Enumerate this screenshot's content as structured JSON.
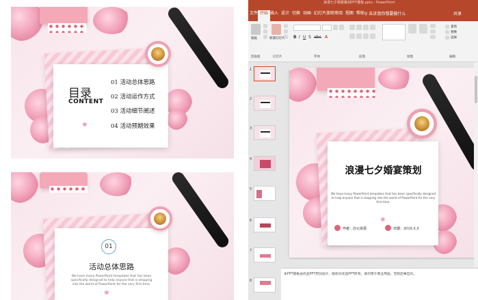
{
  "left_panel": {
    "preview1": {
      "toc_title": "目录",
      "toc_subtitle": "CONTENT",
      "items": [
        "01 活动总体思路",
        "02 活动运作方式",
        "03 活动细节阐述",
        "04 活动预期效果"
      ]
    },
    "preview2": {
      "number": "01",
      "section_title": "活动总体思路",
      "description": "We have many PowerPoint templates that has been specifically designed to help anyone that is stepping into the world of PowerPoint for the very first time."
    }
  },
  "ppt": {
    "title_text": "浪漫七夕婚宴策划PPT模板.pptx - PowerPoint",
    "tabs": [
      "文件",
      "开始",
      "插入",
      "设计",
      "切换",
      "动画",
      "幻灯片放映",
      "审阅",
      "视图",
      "帮助"
    ],
    "active_tab": "开始",
    "tellme_text": "告诉我你想要做什么",
    "share_text": "共享",
    "ribbon_groups": [
      "剪贴板",
      "幻灯片",
      "字体",
      "段落",
      "绘图",
      "编辑"
    ],
    "ribbon_labels": {
      "paste": "粘贴",
      "new_slide": "新建幻灯片",
      "find": "查找",
      "replace": "替换",
      "select": "选择"
    },
    "slide_numbers": [
      "1",
      "2",
      "3",
      "4",
      "5",
      "6",
      "7",
      "8"
    ],
    "main_slide": {
      "title": "浪漫七夕婚宴策划",
      "description": "We have many PowerPoint templates that has been specifically designed to help anyone that is stepping into the world of PowerPoint for the very first time.",
      "author": "作者：办公资源",
      "date": "日期：2019.X.X"
    },
    "notes_text": "本PPT模板由优品PPT原创设计，版权归优品PPT所有，请勿用于商业用途，否则后果自负。"
  }
}
